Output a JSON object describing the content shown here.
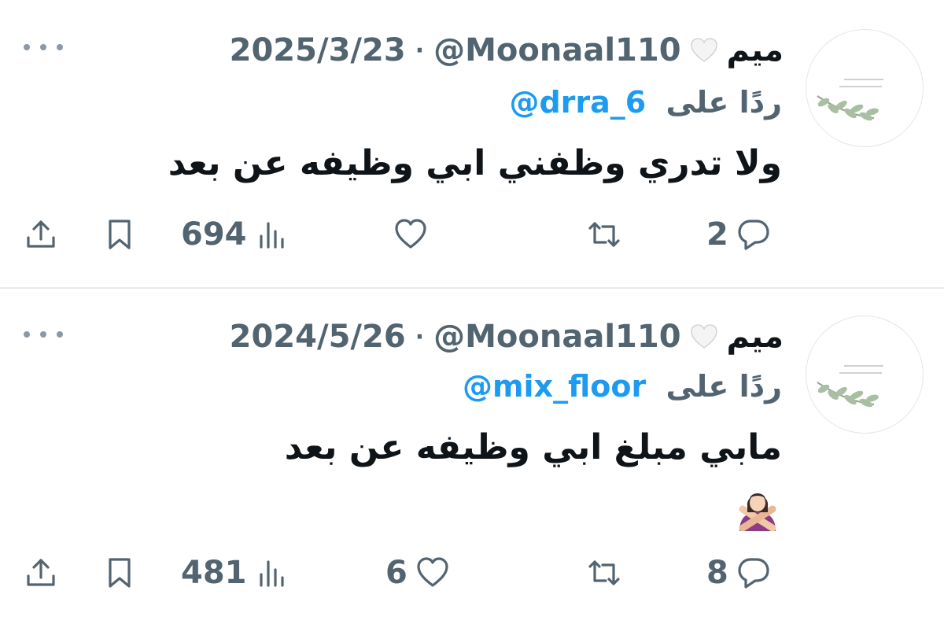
{
  "tweets": [
    {
      "author_name": "ميم",
      "heart_emoji": "white-heart",
      "handle": "@Moonaal110",
      "separator": "·",
      "date": "2025/3/23",
      "reply_label": "ردًا على",
      "reply_to": "@drra_6",
      "text": "ولا تدري وظفني ابي وظيفه عن بعد",
      "emoji": "",
      "reply_count": "2",
      "retweet_count": "",
      "like_count": "",
      "view_count": "694"
    },
    {
      "author_name": "ميم",
      "heart_emoji": "white-heart",
      "handle": "@Moonaal110",
      "separator": "·",
      "date": "2024/5/26",
      "reply_label": "ردًا على",
      "reply_to": "@mix_floor",
      "text": "مابي مبلغ ابي وظيفه عن بعد",
      "emoji": "person-gesturing-no",
      "reply_count": "8",
      "retweet_count": "",
      "like_count": "6",
      "view_count": "481"
    }
  ],
  "icons": {
    "more": "more-horizontal-icon",
    "share": "share-icon",
    "bookmark": "bookmark-icon",
    "views": "views-icon",
    "like": "like-icon",
    "retweet": "retweet-icon",
    "reply": "reply-icon"
  },
  "colors": {
    "text": "#0f1419",
    "secondary": "#536471",
    "link": "#1d9bf0",
    "divider": "#e7e9ea"
  }
}
